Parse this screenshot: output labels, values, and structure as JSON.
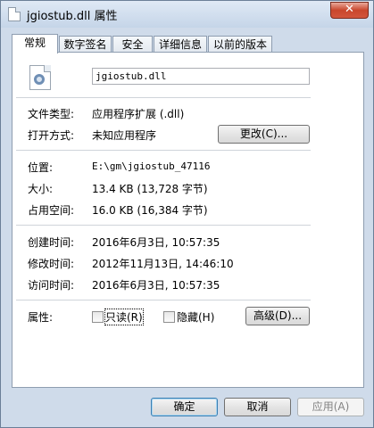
{
  "window": {
    "title": "jgiostub.dll 属性",
    "close_label": "✕"
  },
  "tabs": [
    {
      "label": "常规"
    },
    {
      "label": "数字签名"
    },
    {
      "label": "安全"
    },
    {
      "label": "详细信息"
    },
    {
      "label": "以前的版本"
    }
  ],
  "general": {
    "filename": "jgiostub.dll",
    "file_type_label": "文件类型:",
    "file_type_value": "应用程序扩展 (.dll)",
    "opens_with_label": "打开方式:",
    "opens_with_value": "未知应用程序",
    "change_button": "更改(C)...",
    "location_label": "位置:",
    "location_value": "E:\\gm\\jgiostub_47116",
    "size_label": "大小:",
    "size_value": "13.4 KB (13,728 字节)",
    "size_on_disk_label": "占用空间:",
    "size_on_disk_value": "16.0 KB (16,384 字节)",
    "created_label": "创建时间:",
    "created_value": "2016年6月3日, 10:57:35",
    "modified_label": "修改时间:",
    "modified_value": "2012年11月13日, 14:46:10",
    "accessed_label": "访问时间:",
    "accessed_value": "2016年6月3日, 10:57:35",
    "attributes_label": "属性:",
    "readonly_label": "只读(R)",
    "hidden_label": "隐藏(H)",
    "advanced_button": "高级(D)..."
  },
  "footer": {
    "ok": "确定",
    "cancel": "取消",
    "apply": "应用(A)"
  }
}
